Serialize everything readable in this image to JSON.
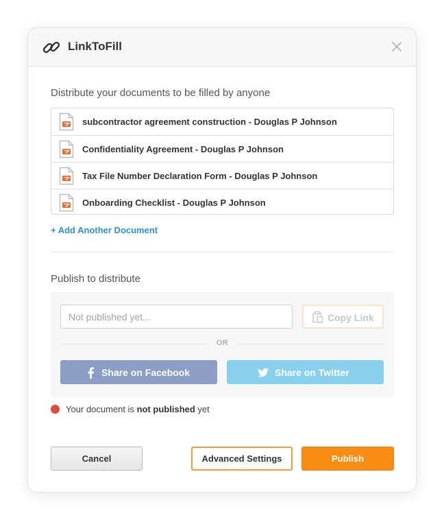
{
  "dialog": {
    "title": "LinkToFill",
    "icons": {
      "title": "link-icon",
      "close": "close-icon"
    }
  },
  "documents": {
    "heading": "Distribute your documents to be filled by anyone",
    "file_icon": "pdf-file-icon",
    "items": [
      {
        "name": "subcontractor agreement construction - Douglas P Johnson"
      },
      {
        "name": "Confidentiality Agreement - Douglas P Johnson"
      },
      {
        "name": "Tax File Number Declaration Form - Douglas P Johnson"
      },
      {
        "name": "Onboarding Checklist - Douglas P Johnson"
      }
    ],
    "add_label": "+ Add Another Document"
  },
  "publish": {
    "heading": "Publish to distribute",
    "link_value": "",
    "link_placeholder": "Not published yet...",
    "copy_label": "Copy Link",
    "or_label": "OR",
    "facebook_label": "Share on Facebook",
    "twitter_label": "Share on Twitter"
  },
  "status": {
    "prefix": "Your document is ",
    "emphasis": "not published",
    "suffix": " yet",
    "color": "#e24a3b"
  },
  "footer": {
    "cancel_label": "Cancel",
    "advanced_label": "Advanced Settings",
    "publish_label": "Publish"
  },
  "colors": {
    "accent_orange": "#f98c13",
    "link_blue": "#2d8fd5",
    "facebook": "#8c9ec6",
    "twitter": "#88d1ee"
  }
}
